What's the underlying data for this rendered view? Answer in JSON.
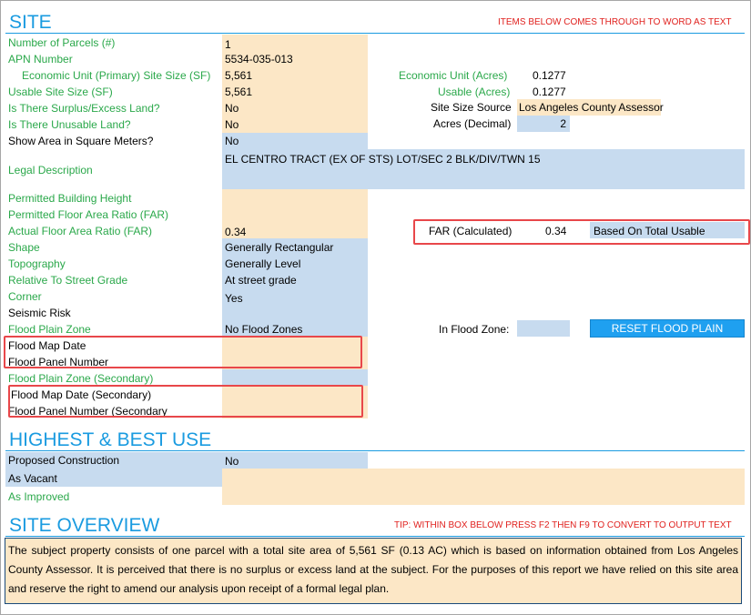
{
  "site": {
    "title": "SITE",
    "note": "ITEMS BELOW COMES THROUGH TO WORD AS TEXT",
    "rows": {
      "parcels": {
        "label": "Number of Parcels (#)",
        "value": "1"
      },
      "apn": {
        "label": "APN Number",
        "value": "5534-035-013"
      },
      "econ_unit": {
        "label": "Economic Unit (Primary) Site Size (SF)",
        "value": "5,561"
      },
      "usable": {
        "label": "Usable Site Size (SF)",
        "value": "5,561"
      },
      "surplus": {
        "label": "Is There Surplus/Excess Land?",
        "value": "No"
      },
      "unusable": {
        "label": "Is There Unusable Land?",
        "value": "No"
      },
      "sqm": {
        "label": "Show Area in Square Meters?",
        "value": "No"
      },
      "legal": {
        "label": "Legal Description",
        "value": "EL CENTRO TRACT (EX OF STS) LOT/SEC 2 BLK/DIV/TWN 15"
      },
      "height": {
        "label": "Permitted Building Height",
        "value": ""
      },
      "pfar": {
        "label": "Permitted Floor Area Ratio (FAR)",
        "value": ""
      },
      "afar": {
        "label": "Actual Floor Area Ratio (FAR)",
        "value": "0.34"
      },
      "shape": {
        "label": "Shape",
        "value": "Generally Rectangular"
      },
      "topography": {
        "label": "Topography",
        "value": "Generally Level"
      },
      "grade": {
        "label": "Relative To Street Grade",
        "value": "At street grade"
      },
      "corner": {
        "label": "Corner",
        "value": "Yes"
      },
      "seismic": {
        "label": "Seismic Risk",
        "value": ""
      },
      "flood_zone": {
        "label": "Flood Plain Zone",
        "value": "No Flood Zones"
      },
      "flood_map_date": {
        "label": "Flood Map Date",
        "value": ""
      },
      "flood_panel": {
        "label": "Flood Panel Number",
        "value": ""
      },
      "flood_zone_sec": {
        "label": "Flood Plain Zone (Secondary)",
        "value": ""
      },
      "flood_map_date_sec": {
        "label": "Flood Map Date (Secondary)",
        "value": ""
      },
      "flood_panel_sec": {
        "label": "Flood Panel Number (Secondary",
        "value": ""
      }
    },
    "right": {
      "econ_acres_label": "Economic Unit (Acres)",
      "econ_acres_value": "0.1277",
      "usable_acres_label": "Usable (Acres)",
      "usable_acres_value": "0.1277",
      "size_source_label": "Site Size Source",
      "size_source_value": "Los Angeles County Assessor",
      "acres_decimal_label": "Acres (Decimal)",
      "acres_decimal_value": "2",
      "far_calc_label": "FAR (Calculated)",
      "far_calc_value": "0.34",
      "far_basis": "Based On Total Usable",
      "in_flood_zone_label": "In Flood Zone:",
      "in_flood_zone_value": "",
      "reset_button": "RESET FLOOD PLAIN"
    }
  },
  "hbu": {
    "title": "HIGHEST & BEST USE",
    "proposed_label": "Proposed Construction",
    "proposed_value": "No",
    "vacant_label": "As Vacant",
    "vacant_value": "",
    "improved_label": "As Improved",
    "improved_value": ""
  },
  "overview": {
    "title": "SITE OVERVIEW",
    "tip": "TIP: WITHIN BOX BELOW PRESS F2 THEN F9 TO CONVERT TO OUTPUT TEXT",
    "text": "The subject property consists of one parcel with a total site area of 5,561 SF (0.13 AC) which is based on information obtained from Los Angeles County Assessor. It is perceived that there is no surplus or excess land at the subject. For the purposes of this report we have relied on this site area and reserve the right to amend our analysis upon receipt of a formal legal plan."
  },
  "colors": {
    "title_blue": "#1a9be0",
    "label_green": "#2aa84a",
    "note_red": "#e0211e",
    "input_peach": "#fce7c6",
    "input_blue": "#c7dbef",
    "button_blue": "#1fa0f0",
    "highlight_red": "#e8474a"
  }
}
